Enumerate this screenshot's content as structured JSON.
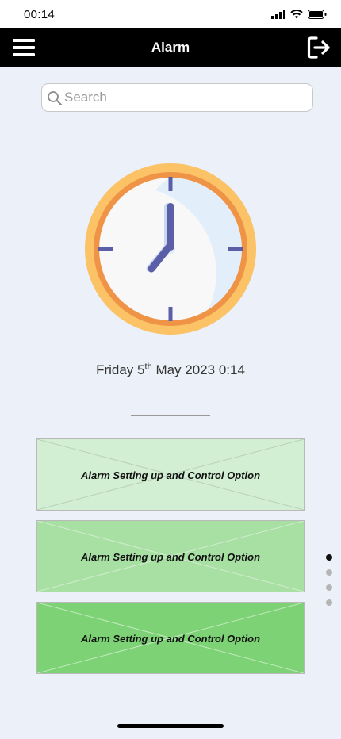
{
  "status_bar": {
    "time": "00:14"
  },
  "header": {
    "title": "Alarm",
    "menu_icon": "hamburger-menu-icon",
    "logout_icon": "logout-icon"
  },
  "search": {
    "placeholder": "Search",
    "value": ""
  },
  "clock": {
    "icon": "clock-icon",
    "hour": 7,
    "minute": 0
  },
  "date": {
    "weekday": "Friday",
    "day": "5",
    "suffix": "th",
    "rest": "May 2023 0:14"
  },
  "options": [
    {
      "label": "Alarm Setting up and Control Option",
      "color": "#d3efd3"
    },
    {
      "label": "Alarm Setting up and Control Option",
      "color": "#a8e0a3"
    },
    {
      "label": "Alarm Setting up and Control Option",
      "color": "#7dd275"
    }
  ],
  "pager": {
    "count": 4,
    "active_index": 0
  },
  "colors": {
    "header_bg": "#000000",
    "page_bg": "#ecf0f8",
    "clock_outer": "#fbc266",
    "clock_ring": "#ef9447",
    "clock_hands": "#5a5fa8"
  }
}
